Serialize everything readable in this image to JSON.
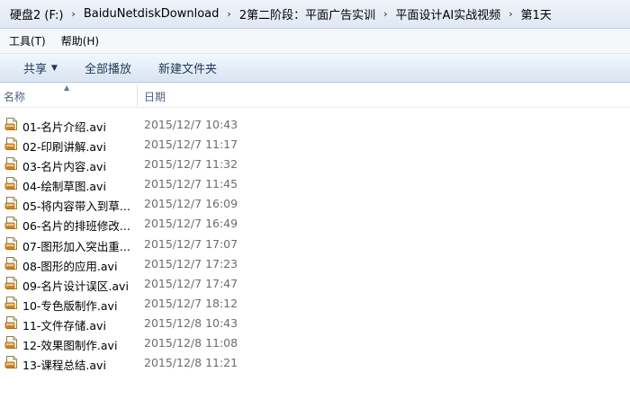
{
  "breadcrumbs": [
    "硬盘2 (F:)",
    "BaiduNetdiskDownload",
    "2第二阶段：平面广告实训",
    "平面设计AI实战视频",
    "第1天"
  ],
  "breadcrumb_separator": "›",
  "menu": [
    {
      "label": "工具(T)"
    },
    {
      "label": "帮助(H)"
    }
  ],
  "toolbar": {
    "share_label": "共享",
    "play_all_label": "全部播放",
    "new_folder_label": "新建文件夹"
  },
  "columns": {
    "name": "名称",
    "date": "日期"
  },
  "icons": {
    "file": "video-file-icon",
    "share_dropdown": "chevron-down-icon",
    "sort": "sort-ascending-icon"
  },
  "colors": {
    "toolbar_text": "#1e395b",
    "date_text": "#6d6d6d",
    "header_text": "#4c607a"
  },
  "files": [
    {
      "name": "01-名片介绍.avi",
      "date": "2015/12/7 10:43"
    },
    {
      "name": "02-印刷讲解.avi",
      "date": "2015/12/7 11:17"
    },
    {
      "name": "03-名片内容.avi",
      "date": "2015/12/7 11:32"
    },
    {
      "name": "04-绘制草图.avi",
      "date": "2015/12/7 11:45"
    },
    {
      "name": "05-将内容带入到草...",
      "date": "2015/12/7 16:09"
    },
    {
      "name": "06-名片的排班修改...",
      "date": "2015/12/7 16:49"
    },
    {
      "name": "07-图形加入突出重...",
      "date": "2015/12/7 17:07"
    },
    {
      "name": "08-图形的应用.avi",
      "date": "2015/12/7 17:23"
    },
    {
      "name": "09-名片设计误区.avi",
      "date": "2015/12/7 17:47"
    },
    {
      "name": "10-专色版制作.avi",
      "date": "2015/12/7 18:12"
    },
    {
      "name": "11-文件存储.avi",
      "date": "2015/12/8 10:43"
    },
    {
      "name": "12-效果图制作.avi",
      "date": "2015/12/8 11:08"
    },
    {
      "name": "13-课程总结.avi",
      "date": "2015/12/8 11:21"
    }
  ]
}
